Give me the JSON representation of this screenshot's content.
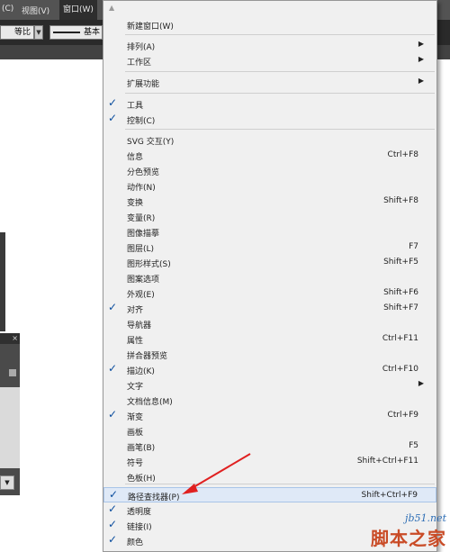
{
  "menubar": {
    "items": [
      "(C)",
      "视图(V)",
      "窗口(W)"
    ]
  },
  "controlbar": {
    "ratio_label": "等比",
    "stroke_label": "基本"
  },
  "panel_close_glyph": "×",
  "menu": {
    "items": [
      {
        "label": "新建窗口(W)"
      },
      {
        "label": "排列(A)",
        "submenu": true
      },
      {
        "label": "工作区",
        "submenu": true
      },
      {
        "label": "扩展功能",
        "submenu": true
      },
      {
        "label": "工具",
        "checked": true
      },
      {
        "label": "控制(C)",
        "checked": true
      },
      {
        "label": "SVG 交互(Y)"
      },
      {
        "label": "信息",
        "shortcut": "Ctrl+F8"
      },
      {
        "label": "分色预览"
      },
      {
        "label": "动作(N)"
      },
      {
        "label": "变换",
        "shortcut": "Shift+F8"
      },
      {
        "label": "变量(R)"
      },
      {
        "label": "图像描摹"
      },
      {
        "label": "图层(L)",
        "shortcut": "F7"
      },
      {
        "label": "图形样式(S)",
        "shortcut": "Shift+F5"
      },
      {
        "label": "图案选项"
      },
      {
        "label": "外观(E)",
        "shortcut": "Shift+F6"
      },
      {
        "label": "对齐",
        "shortcut": "Shift+F7",
        "checked": true
      },
      {
        "label": "导航器"
      },
      {
        "label": "属性",
        "shortcut": "Ctrl+F11"
      },
      {
        "label": "拼合器预览"
      },
      {
        "label": "描边(K)",
        "shortcut": "Ctrl+F10",
        "checked": true
      },
      {
        "label": "文字",
        "submenu": true
      },
      {
        "label": "文档信息(M)"
      },
      {
        "label": "渐变",
        "shortcut": "Ctrl+F9",
        "checked": true
      },
      {
        "label": "画板"
      },
      {
        "label": "画笔(B)",
        "shortcut": "F5"
      },
      {
        "label": "符号",
        "shortcut": "Shift+Ctrl+F11"
      },
      {
        "label": "色板(H)"
      },
      {
        "label": "路径查找器(P)",
        "shortcut": "Shift+Ctrl+F9",
        "checked": true,
        "highlighted": true
      },
      {
        "label": "透明度",
        "checked": true
      },
      {
        "label": "链接(I)",
        "checked": true
      },
      {
        "label": "颜色",
        "checked": true
      }
    ]
  },
  "colors": {
    "check": "#0a4d9e",
    "arrow": "#e02020",
    "watermark_url": "#2f6fb6",
    "watermark_name": "#c94b26"
  },
  "watermark": {
    "url": "jb51.net",
    "name": "脚本之家"
  }
}
